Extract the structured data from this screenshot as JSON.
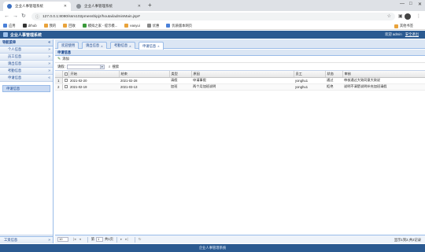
{
  "browser": {
    "tabs": [
      {
        "title": "企业人事管理系统",
        "active": true
      },
      {
        "title": "企业人事管理系统",
        "active": false
      }
    ],
    "url": "127.0.0.1:8080/ssm102pmenshipjz/houtai/adminMain.jsp#",
    "bookmarks": [
      "应用",
      "drhub",
      "我的",
      "回收",
      "模拟之家 - 提示模...",
      "easyui",
      "优惠",
      "优质版本网页"
    ],
    "other_bookmarks": "其他书签"
  },
  "app": {
    "title": "企业人事管理系统",
    "user_text": "欢迎 admin",
    "logout": "安全退出",
    "footer": "企业人事管理系统"
  },
  "sidebar": {
    "header": "导航菜单",
    "sections": [
      "个人信息",
      "员工信息",
      "请出信息",
      "考勤信息",
      "申请信息"
    ],
    "active_sub_item": "申请信息",
    "bottom_section": "工资信息"
  },
  "content_tabs": [
    {
      "label": "欢迎使用",
      "closable": false,
      "active": false
    },
    {
      "label": "请出信息",
      "closable": true,
      "active": false
    },
    {
      "label": "考勤信息",
      "closable": true,
      "active": false
    },
    {
      "label": "申请信息",
      "closable": true,
      "active": true
    }
  ],
  "panel": {
    "title": "申请信息",
    "add_label": "添加",
    "filter_label": "请假:",
    "search_label": "搜索"
  },
  "grid": {
    "columns": [
      "开始",
      "结束",
      "类型",
      "原因",
      "员工",
      "状态",
      "审核"
    ],
    "rows": [
      {
        "n": "1",
        "start": "2021-02-20",
        "end": "2021-02-28",
        "type": "请假",
        "reason": "申请事假",
        "employee": "yonghu1",
        "status": "通过",
        "review": "审核通过大致同意大致说"
      },
      {
        "n": "2",
        "start": "2021-02-19",
        "end": "2021-03-13",
        "type": "加班",
        "reason": "两个月加班说明",
        "employee": "yonghu1",
        "status": "拒绝",
        "review": "说明不清楚说明补充加班请假"
      }
    ]
  },
  "pager": {
    "page_size": "10",
    "page_label": "第",
    "page_value": "1",
    "total_pages": "共1页",
    "info": "显示1到2,共2记录"
  }
}
